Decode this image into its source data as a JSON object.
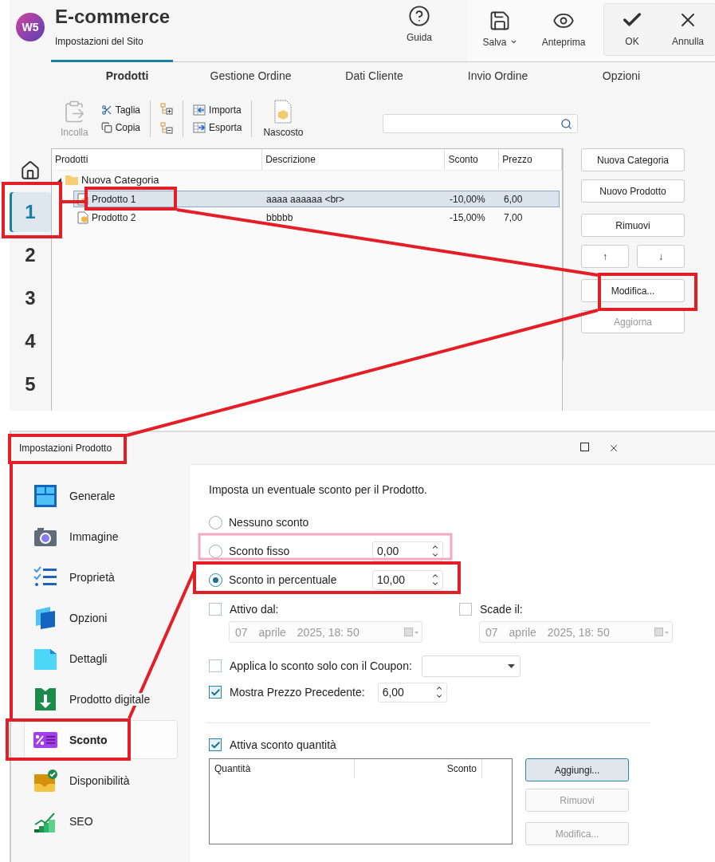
{
  "app": {
    "logo": "W5",
    "title": "E-commerce",
    "subtitle": "Impostazioni del Sito"
  },
  "nav": [
    {
      "label": "1",
      "selected": true
    },
    {
      "label": "2",
      "selected": false
    },
    {
      "label": "3",
      "selected": false
    },
    {
      "label": "4",
      "selected": false
    },
    {
      "label": "5",
      "selected": false
    }
  ],
  "header_buttons": [
    {
      "kind": "help",
      "label": "Guida"
    },
    {
      "kind": "save",
      "label": "Salva"
    },
    {
      "kind": "preview",
      "label": "Anteprima"
    },
    {
      "kind": "ok",
      "label": "OK"
    },
    {
      "kind": "cancel",
      "label": "Annulla"
    }
  ],
  "tabs": [
    {
      "label": "Prodotti",
      "selected": true
    },
    {
      "label": "Gestione Ordine",
      "selected": false
    },
    {
      "label": "Dati Cliente",
      "selected": false
    },
    {
      "label": "Invio Ordine",
      "selected": false
    },
    {
      "label": "Opzioni",
      "selected": false
    }
  ],
  "toolbar": {
    "paste": {
      "label": "Incolla",
      "disabled": true
    },
    "cut": "Taglia",
    "copy": "Copia",
    "import": "Importa",
    "export": "Esporta",
    "hidden": "Nascosto"
  },
  "table": {
    "columns": [
      "Prodotti",
      "Descrizione",
      "Sconto",
      "Prezzo"
    ],
    "rows": [
      {
        "name": "Nuova Categoria",
        "expanded": true,
        "children": [
          {
            "name": "Prodotto 1",
            "description": "aaaa aaaaaa <br>",
            "discount": "-10,00%",
            "price": "6,00",
            "selected": true
          },
          {
            "name": "Prodotto 2",
            "description": "bbbbb",
            "discount": "-15,00%",
            "price": "7,00",
            "selected": false
          }
        ]
      }
    ]
  },
  "side_buttons": [
    {
      "kind": "wide",
      "label": "Nuova Categoria",
      "disabled": false
    },
    {
      "kind": "wide",
      "label": "Nuovo Prodotto",
      "disabled": false
    },
    {
      "kind": "wide",
      "label": "Rimuovi",
      "disabled": false
    },
    {
      "kind": "half",
      "label": "↑",
      "disabled": false
    },
    {
      "kind": "half",
      "label": "↓",
      "disabled": false
    },
    {
      "kind": "wide",
      "label": "Modifica...",
      "disabled": false
    },
    {
      "kind": "wide",
      "label": "Aggiorna",
      "disabled": true
    }
  ],
  "dialog": {
    "title": "Impostazioni Prodotto",
    "sections": [
      {
        "kind": "general",
        "label": "Generale",
        "selected": false
      },
      {
        "kind": "image",
        "label": "Immagine",
        "selected": false
      },
      {
        "kind": "properties",
        "label": "Proprietà",
        "selected": false
      },
      {
        "kind": "options",
        "label": "Opzioni",
        "selected": false
      },
      {
        "kind": "details",
        "label": "Dettagli",
        "selected": false
      },
      {
        "kind": "digital",
        "label": "Prodotto digitale",
        "selected": false
      },
      {
        "kind": "discount",
        "label": "Sconto",
        "selected": true
      },
      {
        "kind": "availability",
        "label": "Disponibilità",
        "selected": false
      },
      {
        "kind": "seo",
        "label": "SEO",
        "selected": false
      }
    ],
    "intro": "Imposta un eventuale sconto per il Prodotto.",
    "discount_options": [
      {
        "label": "Nessuno sconto",
        "selected": false
      },
      {
        "label": "Sconto fisso",
        "selected": false,
        "value": "0,00"
      },
      {
        "label": "Sconto in percentuale",
        "selected": true,
        "value": "10,00"
      }
    ],
    "dates": [
      {
        "label": "Attivo dal:",
        "checked": false,
        "day": "07",
        "month": "aprile",
        "time": "2025, 18: 50"
      },
      {
        "label": "Scade il:",
        "checked": false,
        "day": "07",
        "month": "aprile",
        "time": "2025, 18: 50"
      }
    ],
    "coupon": {
      "label": "Applica lo sconto solo con il Coupon:",
      "checked": false
    },
    "previous_price": {
      "label": "Mostra Prezzo Precedente:",
      "checked": true,
      "value": "6,00"
    },
    "quantity_discount": {
      "label": "Attiva sconto quantità",
      "checked": true,
      "columns": [
        "Quantità",
        "Sconto"
      ],
      "buttons": [
        {
          "label": "Aggiungi...",
          "disabled": false
        },
        {
          "label": "Rimuovi",
          "disabled": true
        },
        {
          "label": "Modifica...",
          "disabled": true
        }
      ]
    }
  }
}
